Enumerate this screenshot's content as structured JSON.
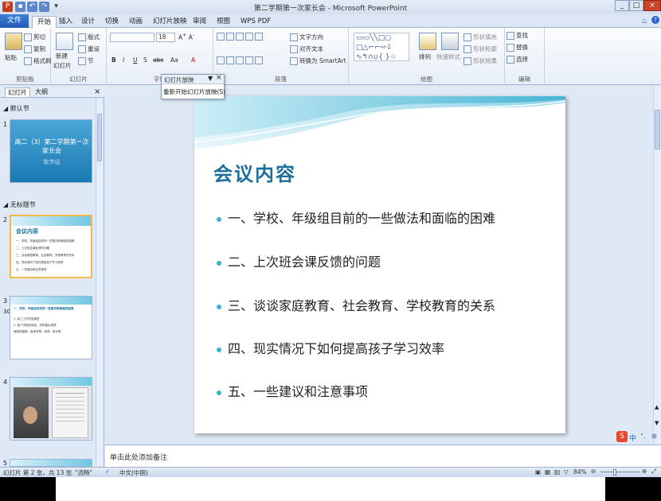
{
  "window": {
    "title": "第二学期第一次家长会 - Microsoft PowerPoint",
    "controls": [
      "_",
      "□",
      "×"
    ]
  },
  "tabs": [
    "文件",
    "开始",
    "插入",
    "设计",
    "切换",
    "动画",
    "幻灯片放映",
    "审阅",
    "视图",
    "WPS PDF"
  ],
  "ribbon": {
    "clipboard": {
      "paste": "粘贴",
      "cut": "剪切",
      "copy": "复制",
      "format": "格式刷",
      "label": "剪贴板"
    },
    "slides": {
      "new": "新建",
      "new2": "幻灯片",
      "layout": "版式",
      "reset": "重设",
      "section": "节",
      "label": "幻灯片"
    },
    "font": {
      "size": "18",
      "bold": "B",
      "italic": "I",
      "underline": "U",
      "strike": "S",
      "abc": "abc",
      "aa": "Aa",
      "label": "字体"
    },
    "paragraph": {
      "textdir": "文字方向",
      "align": "对齐文本",
      "smartart": "转换为 SmartArt",
      "label": "段落"
    },
    "drawing": {
      "arrange": "排列",
      "quickstyle": "快速样式",
      "fill": "形状填充",
      "outline": "形状轮廓",
      "effect": "形状效果",
      "label": "绘图"
    },
    "editing": {
      "find": "查找",
      "replace": "替换",
      "select": "选择",
      "label": "编辑"
    }
  },
  "popup": {
    "title": "幻灯片放映",
    "item": "重新开始幻灯片放映(S)"
  },
  "leftpanel": {
    "tabs": [
      "幻灯片",
      "大纲"
    ],
    "section_default": "默认节",
    "section_untitled": "无标题节",
    "slide_numbers": [
      "1",
      "2",
      "3",
      "4",
      "5"
    ],
    "thumb1_title": "高二（3）第二学期第一次家长会",
    "thumb1_sub": "数学组",
    "thumb2_title": "会议内容",
    "thumb2_lines": [
      "一、学校、年级组目前的一些做法和面临的困难",
      "二、上次班会课反馈的问题",
      "三、谈谈家庭教育、社会教育、学校教育的关系",
      "四、现实情况下如何提高孩子学习效率",
      "五、一些建议和注意事项"
    ],
    "thumb3_title": "一、学校、年级组目前的一些做法和面临的困难",
    "thumb3_lines": [
      "1. 高三工作开始推进",
      "2. 各个学段安排会，学校做出成绩",
      "   面临的困难：高考改革、师资、家长等"
    ],
    "thumb3_tag": "30"
  },
  "slide": {
    "title": "会议内容",
    "bullets": [
      "一、学校、年级组目前的一些做法和面临的困难",
      "二、上次班会课反馈的问题",
      "三、谈谈家庭教育、社会教育、学校教育的关系",
      "四、现实情况下如何提高孩子学习效率",
      "五、一些建议和注意事项"
    ]
  },
  "notes": {
    "placeholder": "单击此处添加备注"
  },
  "status": {
    "slide_info": "幻灯片 第 2 张，共 13 张",
    "theme": "\"流畅\"",
    "lang": "中文(中国)",
    "zoom": "84%"
  },
  "ime": {
    "text": "中"
  },
  "colors": {
    "accent": "#1d6e9a",
    "bullet": "#3bb0d0",
    "file_tab": "#2a67c4"
  }
}
